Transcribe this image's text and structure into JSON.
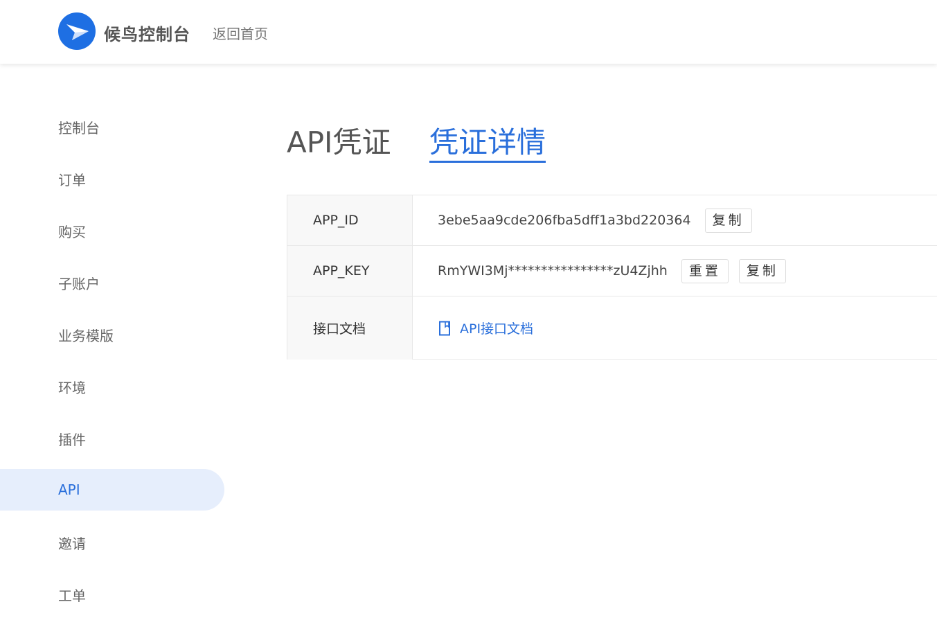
{
  "header": {
    "brand": "候鸟控制台",
    "home_link": "返回首页"
  },
  "sidebar": {
    "items": [
      {
        "label": "控制台"
      },
      {
        "label": "订单"
      },
      {
        "label": "购买"
      },
      {
        "label": "子账户"
      },
      {
        "label": "业务模版"
      },
      {
        "label": "环境"
      },
      {
        "label": "插件"
      },
      {
        "label": "API",
        "active": true
      },
      {
        "label": "邀请"
      },
      {
        "label": "工单"
      }
    ]
  },
  "tabs": {
    "api_label": "API凭证",
    "detail_label": "凭证详情",
    "active": "凭证详情"
  },
  "credentials": {
    "app_id": {
      "label": "APP_ID",
      "value": "3ebe5aa9cde206fba5dff1a3bd220364",
      "copy_label": "复制"
    },
    "app_key": {
      "label": "APP_KEY",
      "value": "RmYWI3Mj****************zU4Zjhh",
      "reset_label": "重置",
      "copy_label": "复制"
    },
    "docs": {
      "label": "接口文档",
      "link_label": "API接口文档"
    }
  },
  "colors": {
    "accent": "#2a6fdb",
    "logo": "#1e6fe3",
    "active_nav_bg": "#e6eefc"
  },
  "icons": {
    "logo": "bird-logo-icon",
    "doc": "document-icon"
  }
}
